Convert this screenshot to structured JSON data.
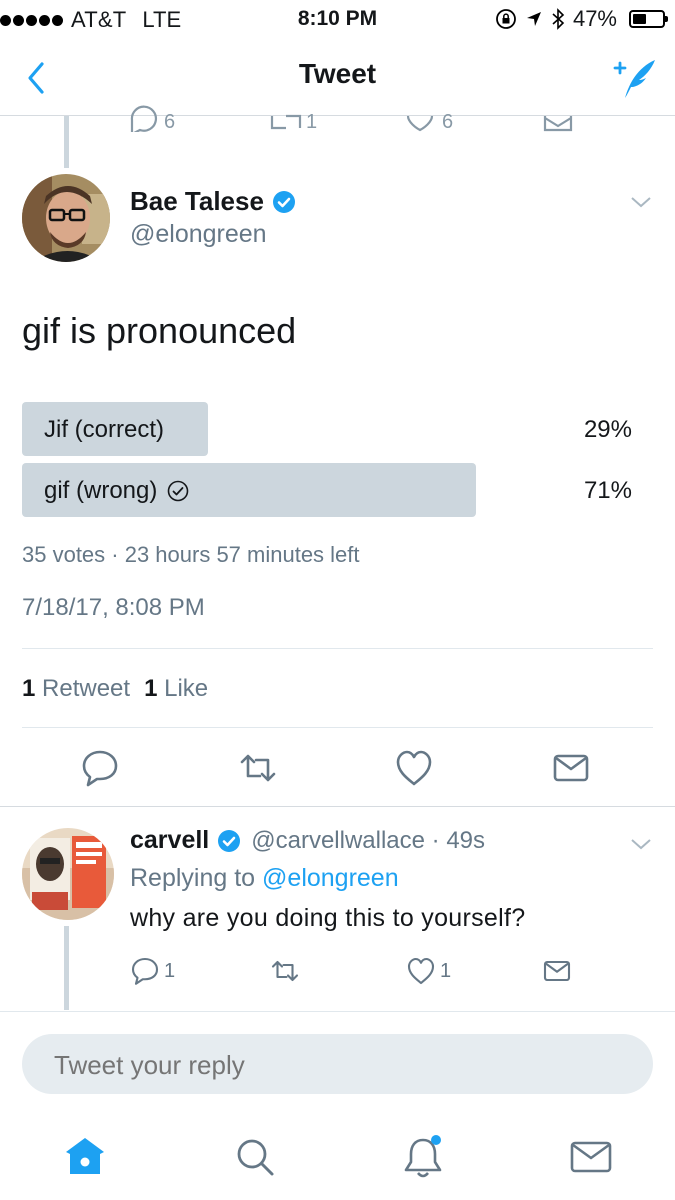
{
  "status_bar": {
    "carrier": "AT&T",
    "network": "LTE",
    "time": "8:10 PM",
    "battery": "47%",
    "battery_level": 0.47
  },
  "nav": {
    "title": "Tweet",
    "back_icon": "chevron-left-icon",
    "compose_icon": "compose-tweet-icon"
  },
  "tweet": {
    "author_name": "Bae Talese",
    "author_handle": "@elongreen",
    "verified": true,
    "text": "gif is pronounced",
    "poll": {
      "options": [
        {
          "label": "Jif (correct)",
          "percent": "29%",
          "fraction": 0.29,
          "selected": false
        },
        {
          "label": "gif (wrong)",
          "percent": "71%",
          "fraction": 0.71,
          "selected": true
        }
      ],
      "meta": "35 votes · 23 hours 57 minutes left"
    },
    "timestamp": "7/18/17, 8:08 PM",
    "stats": {
      "retweet_count": "1",
      "retweet_label": "Retweet",
      "like_count": "1",
      "like_label": "Like"
    }
  },
  "reply": {
    "author_name": "carvell",
    "author_handle": "@carvellwallace · 49s",
    "verified": true,
    "replying_prefix": "Replying to",
    "replying_to": "@elongreen",
    "text": "why are you doing this to yourself?",
    "reply_count": "1",
    "like_count": "1"
  },
  "composer": {
    "placeholder": "Tweet your reply"
  },
  "colors": {
    "accent": "#1da1f2",
    "muted": "#657786",
    "poll_bar": "#ccd6dd"
  }
}
